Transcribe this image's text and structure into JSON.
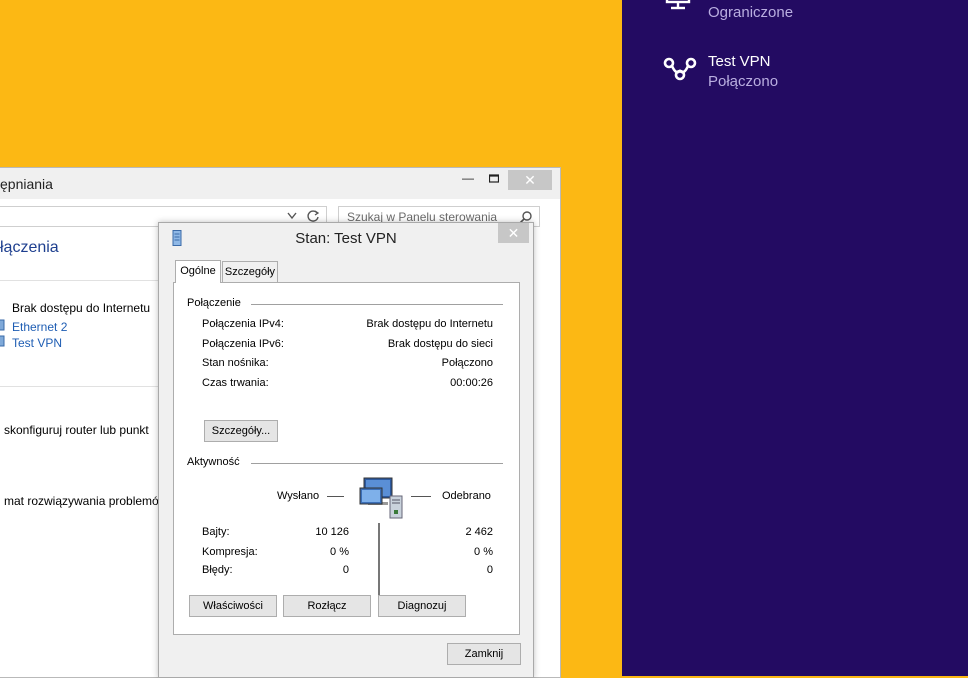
{
  "charm": {
    "networks": [
      {
        "name": "",
        "status": "Ograniczone",
        "icon": "monitor-network-icon"
      },
      {
        "name": "Test VPN",
        "status": "Połączono",
        "icon": "vpn-icon"
      }
    ]
  },
  "control_panel": {
    "title": "ępniania",
    "search_placeholder": "Szukaj w Panelu sterowania",
    "header": "łączenia",
    "access_type": "Brak dostępu do Internetu",
    "connections": [
      "Ethernet 2",
      "Test VPN"
    ],
    "setup_link": "skonfiguruj router lub punkt",
    "troubleshoot_link": "mat rozwiązywania problemów"
  },
  "dialog": {
    "title": "Stan: Test VPN",
    "tabs": [
      "Ogólne",
      "Szczegóły"
    ],
    "connection": {
      "group_label": "Połączenie",
      "rows": [
        {
          "label": "Połączenia IPv4:",
          "value": "Brak dostępu do Internetu"
        },
        {
          "label": "Połączenia IPv6:",
          "value": "Brak dostępu do sieci"
        },
        {
          "label": "Stan nośnika:",
          "value": "Połączono"
        },
        {
          "label": "Czas trwania:",
          "value": "00:00:26"
        }
      ],
      "details_button": "Szczegóły..."
    },
    "activity": {
      "group_label": "Aktywność",
      "sent_label": "Wysłano",
      "received_label": "Odebrano",
      "rows": [
        {
          "label": "Bajty:",
          "sent": "10 126",
          "received": "2 462"
        },
        {
          "label": "Kompresja:",
          "sent": "0 %",
          "received": "0 %"
        },
        {
          "label": "Błędy:",
          "sent": "0",
          "received": "0"
        }
      ]
    },
    "buttons": {
      "properties": "Właściwości",
      "disconnect": "Rozłącz",
      "diagnose": "Diagnozuj",
      "close": "Zamknij"
    }
  },
  "colors": {
    "desktop": "#fcb814",
    "charm_panel": "#230b62",
    "link": "#1e5db3"
  }
}
